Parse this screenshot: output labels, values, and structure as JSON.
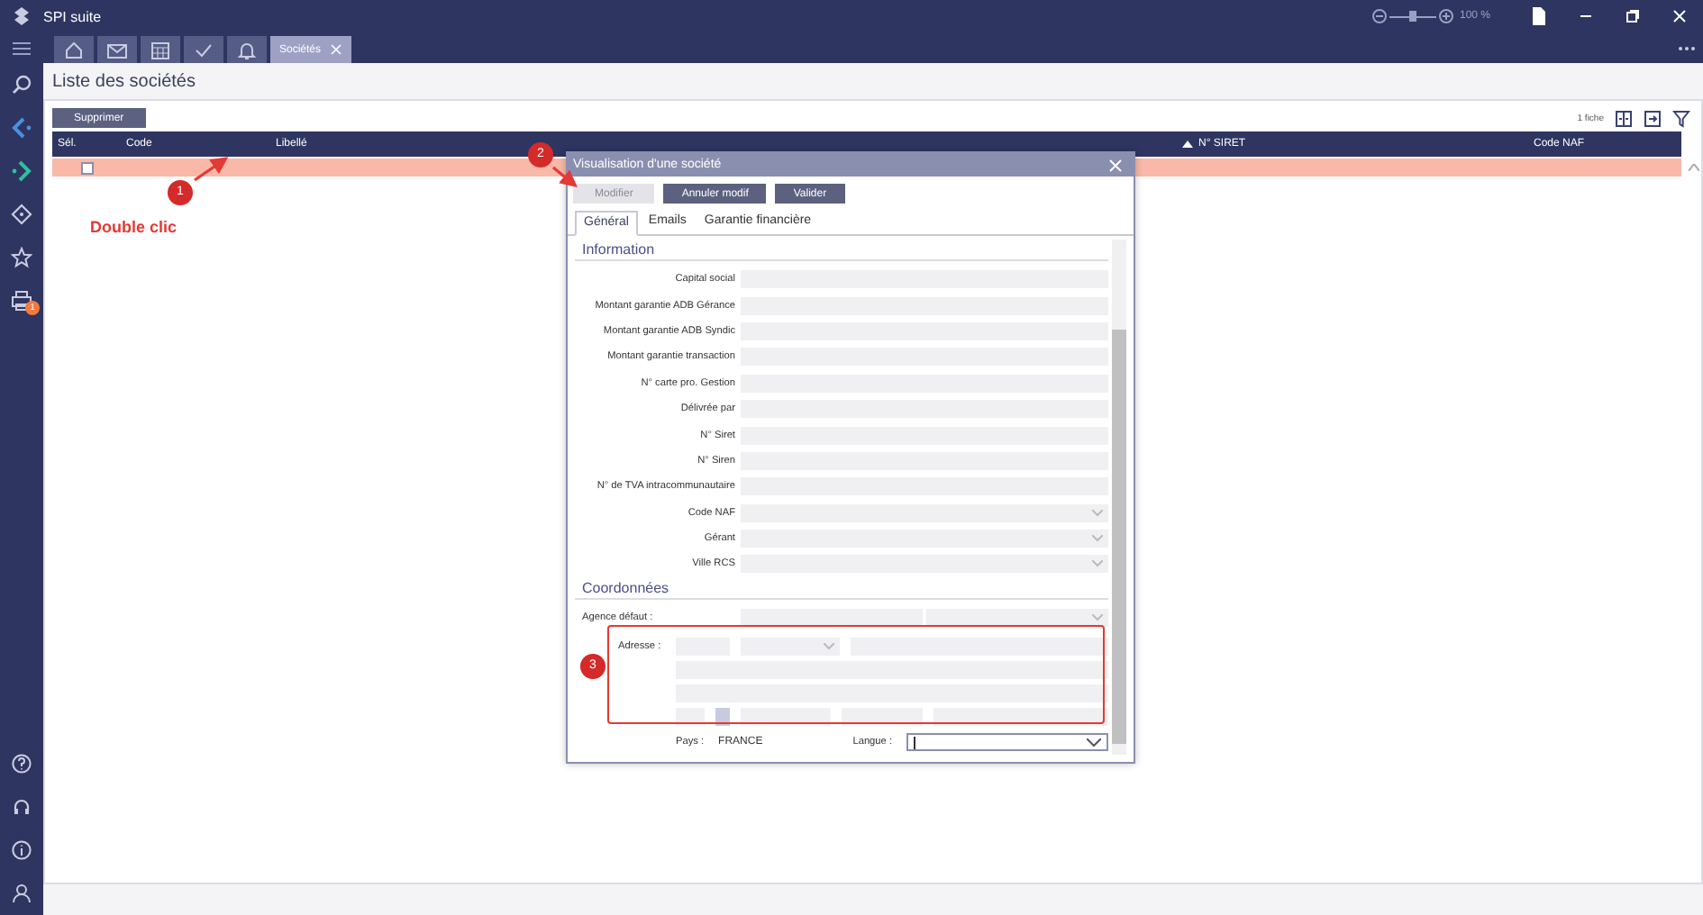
{
  "app": {
    "title": "SPI suite",
    "zoom_slider": {
      "level": 0.5
    },
    "zoom": "100 %"
  },
  "tabs": [
    {
      "kind": "home",
      "selected": false
    },
    {
      "kind": "mail",
      "selected": false
    },
    {
      "kind": "calendar",
      "selected": false
    },
    {
      "kind": "check",
      "selected": false
    },
    {
      "kind": "bell",
      "selected": false
    },
    {
      "kind": "text",
      "label": "Sociétés",
      "selected": true
    }
  ],
  "sidebar": {
    "items": [
      {
        "kind": "search"
      },
      {
        "kind": "back"
      },
      {
        "kind": "forward"
      },
      {
        "kind": "diamond"
      },
      {
        "kind": "star"
      },
      {
        "kind": "printer",
        "badge": "1"
      }
    ],
    "bottom_items": [
      {
        "kind": "help"
      },
      {
        "kind": "headset"
      },
      {
        "kind": "info"
      },
      {
        "kind": "user"
      }
    ]
  },
  "page": {
    "title": "Liste des sociétés",
    "buttons": [
      "Supprimer"
    ],
    "record_count": "1 fiche"
  },
  "table": {
    "columns": [
      {
        "label": "Sél.",
        "sorted": false
      },
      {
        "label": "Code",
        "sorted": false
      },
      {
        "label": "Libellé",
        "sorted": false
      },
      {
        "label": "N° SIRET",
        "sorted": true
      },
      {
        "label": "Code NAF",
        "sorted": false
      }
    ],
    "rows": [
      {
        "selected": true,
        "checked": false
      }
    ]
  },
  "dialog": {
    "title": "Visualisation d'une société",
    "buttons": [
      {
        "label": "Modifier",
        "disabled": true
      },
      {
        "label": "Annuler modif",
        "disabled": false
      },
      {
        "label": "Valider",
        "disabled": false
      }
    ],
    "tabs": [
      {
        "label": "Général",
        "selected": true
      },
      {
        "label": "Emails",
        "selected": false
      },
      {
        "label": "Garantie financière",
        "selected": false
      }
    ],
    "sections": [
      {
        "title": "Information",
        "fields": [
          {
            "label": "Capital social",
            "kind": "text"
          },
          {
            "label": "Montant garantie ADB Gérance",
            "kind": "text"
          },
          {
            "label": "Montant garantie ADB Syndic",
            "kind": "text"
          },
          {
            "label": "Montant garantie transaction",
            "kind": "text"
          },
          {
            "label": "N° carte pro. Gestion",
            "kind": "text"
          },
          {
            "label": "Délivrée par",
            "kind": "text"
          },
          {
            "label": "N° Siret",
            "kind": "text"
          },
          {
            "label": "N° Siren",
            "kind": "text"
          },
          {
            "label": "N° de TVA intracommunautaire",
            "kind": "text"
          },
          {
            "label": "Code NAF",
            "kind": "select"
          },
          {
            "label": "Gérant",
            "kind": "select"
          },
          {
            "label": "Ville RCS",
            "kind": "select"
          }
        ]
      },
      {
        "title": "Coordonnées",
        "fields": [
          {
            "label": "Agence défaut :",
            "kind": "double"
          }
        ]
      }
    ],
    "address": {
      "label": "Adresse :"
    },
    "country": {
      "label": "Pays :",
      "value": "FRANCE"
    },
    "language": {
      "label": "Langue :"
    }
  },
  "annotations": [
    {
      "number": "1",
      "caption": "Double clic"
    },
    {
      "number": "2"
    },
    {
      "number": "3"
    }
  ]
}
